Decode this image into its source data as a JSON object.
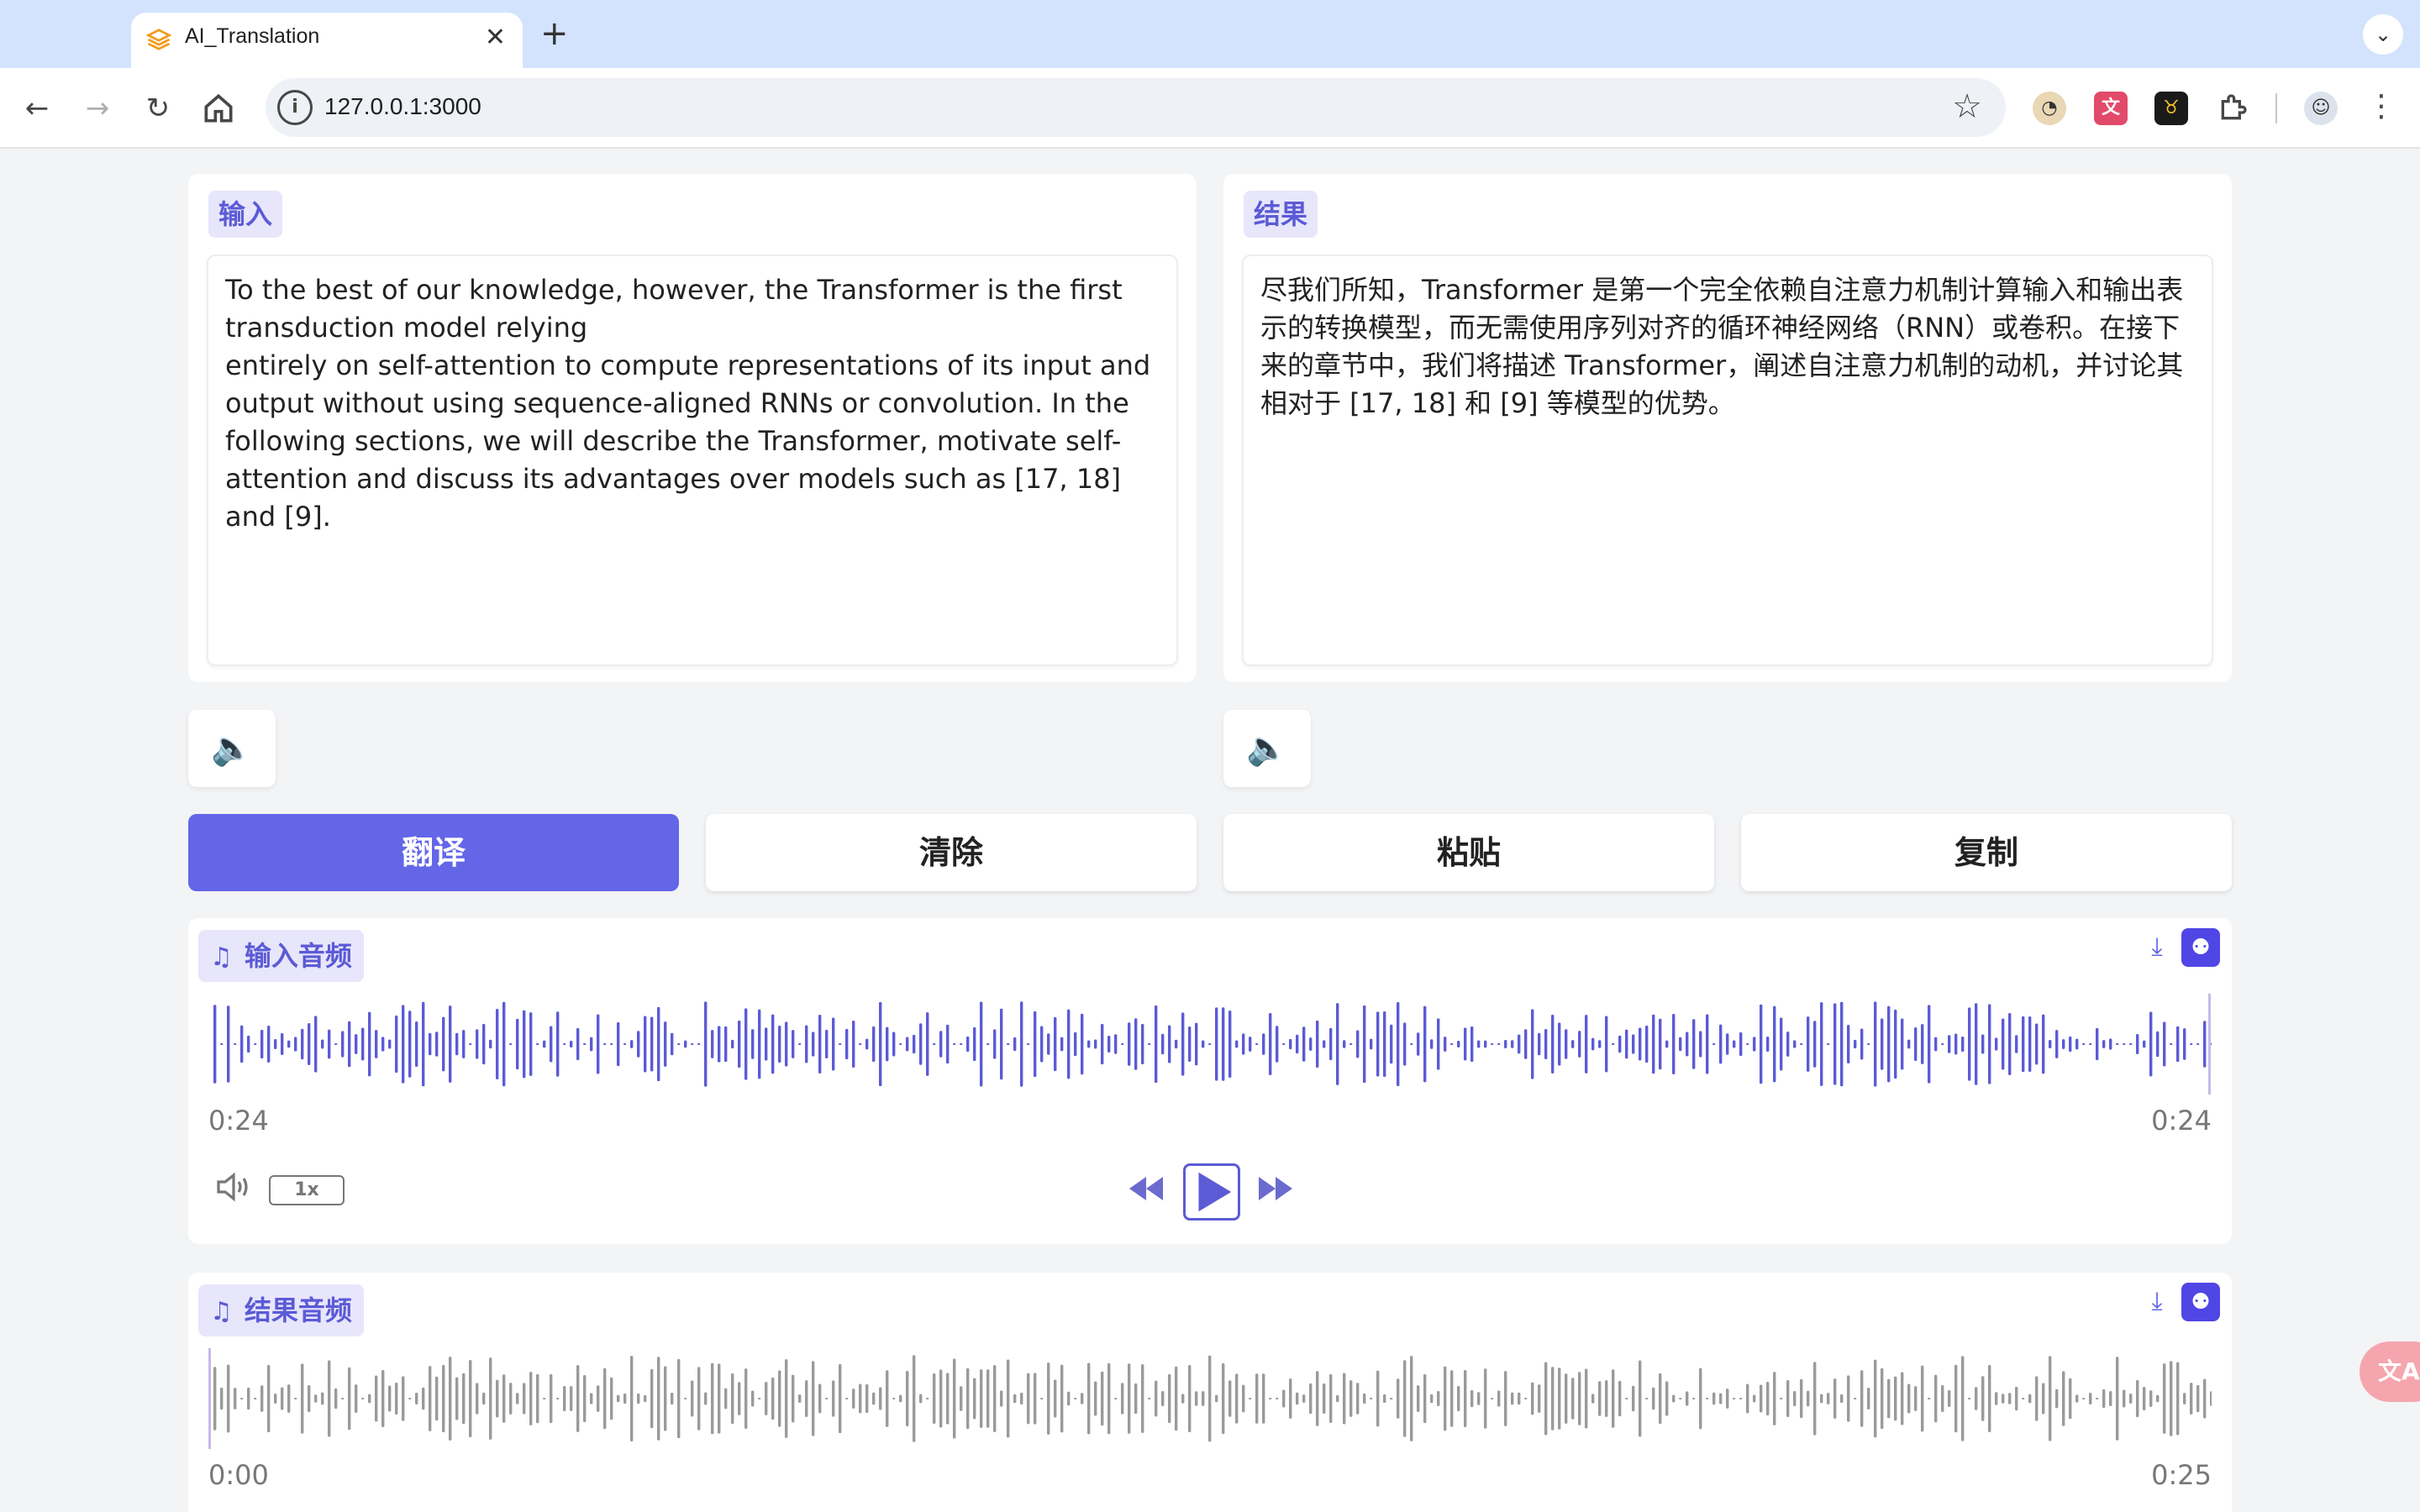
{
  "browser": {
    "tab_title": "AI_Translation",
    "tab_close": "✕",
    "new_tab": "+",
    "url": "127.0.0.1:3000",
    "tab_search": "⌄"
  },
  "input_panel": {
    "label": "输入",
    "text": "To the best of our knowledge, however, the Transformer is the first transduction model relying\nentirely on self-attention to compute representations of its input and output without using sequence-aligned RNNs or convolution. In the following sections, we will describe the Transformer, motivate self-attention and discuss its advantages over models such as [17, 18] and [9]."
  },
  "result_panel": {
    "label": "结果",
    "text": "尽我们所知，Transformer 是第一个完全依赖自注意力机制计算输入和输出表示的转换模型，而无需使用序列对齐的循环神经网络（RNN）或卷积。在接下来的章节中，我们将描述 Transformer，阐述自注意力机制的动机，并讨论其相对于 [17, 18] 和 [9] 等模型的优势。"
  },
  "actions": {
    "translate": "翻译",
    "clear": "清除",
    "paste": "粘贴",
    "copy": "复制"
  },
  "input_audio": {
    "label": "输入音频",
    "current_time": "0:24",
    "duration": "0:24",
    "speed": "1x",
    "progress": 1.0,
    "wave_color": "#5b5bd6"
  },
  "result_audio": {
    "label": "结果音频",
    "current_time": "0:00",
    "duration": "0:25",
    "progress": 0.0,
    "wave_color": "#9a9a9a"
  },
  "colors": {
    "accent": "#6366e7",
    "tag_bg": "#e8e6fb",
    "tag_text": "#5b5bd6"
  },
  "icons": [
    "back-icon",
    "forward-icon",
    "reload-icon",
    "home-icon",
    "site-info-icon",
    "bookmark-star-icon",
    "speaker-icon",
    "music-note-icon",
    "download-icon",
    "robot-icon",
    "volume-icon",
    "rewind-icon",
    "play-icon",
    "fast-forward-icon",
    "translate-icon"
  ]
}
